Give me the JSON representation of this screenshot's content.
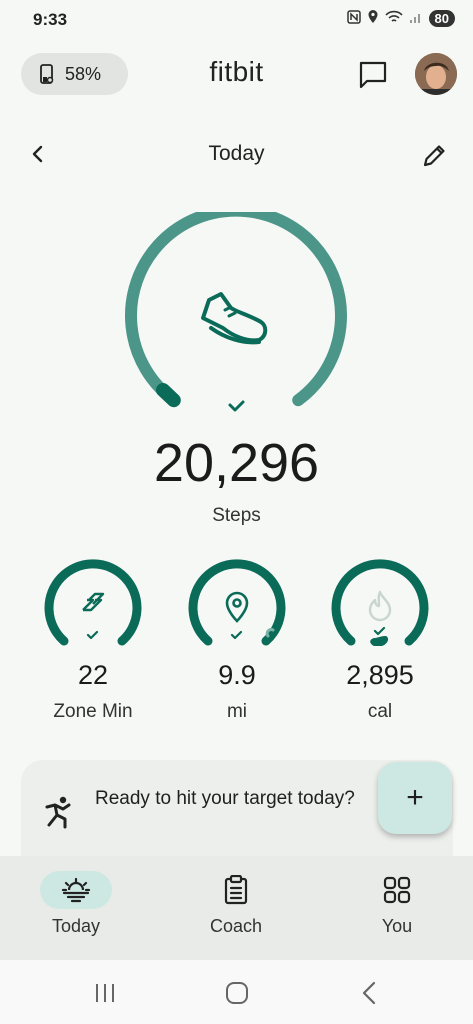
{
  "status_bar": {
    "time": "9:33",
    "battery": "80"
  },
  "header": {
    "device_battery": "58%",
    "app_name": "fitbit"
  },
  "page": {
    "title": "Today"
  },
  "steps": {
    "value": "20,296",
    "label": "Steps",
    "progress": 0.9
  },
  "stats": [
    {
      "value": "22",
      "label": "Zone Min",
      "icon": "zone-minutes-icon"
    },
    {
      "value": "9.9",
      "label": "mi",
      "icon": "location-pin-icon"
    },
    {
      "value": "2,895",
      "label": "cal",
      "icon": "flame-icon"
    }
  ],
  "coach_card": {
    "text": "Ready to hit your target today?",
    "action": "+"
  },
  "bottom_nav": [
    {
      "label": "Today",
      "icon": "sunrise-icon",
      "active": true
    },
    {
      "label": "Coach",
      "icon": "clipboard-icon",
      "active": false
    },
    {
      "label": "You",
      "icon": "grid-icon",
      "active": false
    }
  ],
  "colors": {
    "accent": "#4c9689",
    "accent_dark": "#0b6b59",
    "chip_bg": "#e1e4e0",
    "nav_active": "#cde8e2"
  }
}
